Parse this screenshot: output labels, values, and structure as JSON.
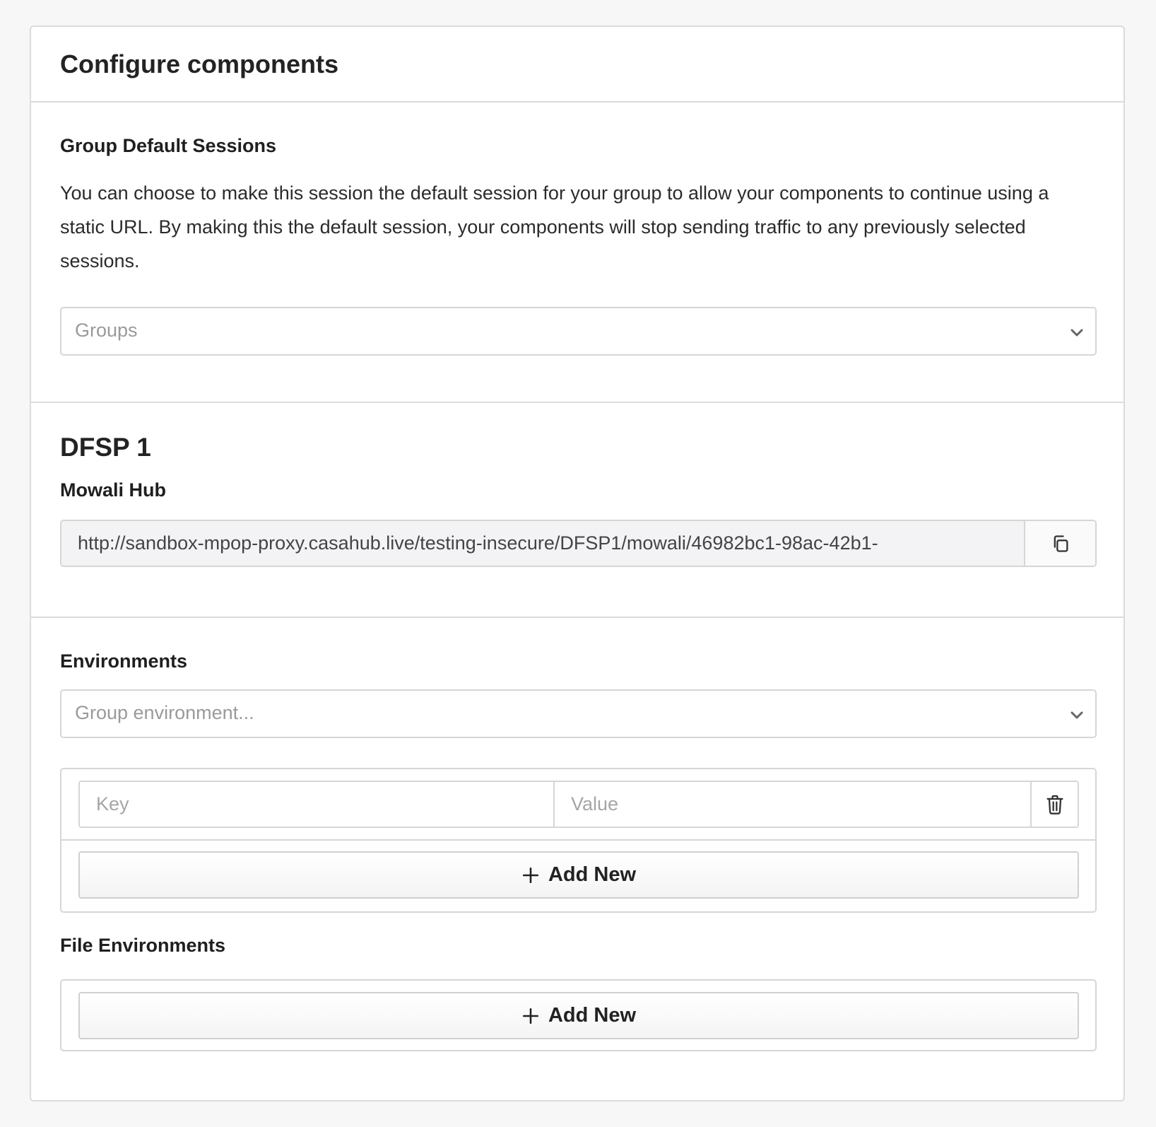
{
  "card": {
    "title": "Configure components"
  },
  "group_defaults": {
    "heading": "Group Default Sessions",
    "description": "You can choose to make this session the default session for your group to allow your components to continue using a static URL. By making this the default session, your components will stop sending traffic to any previously selected sessions.",
    "select_placeholder": "Groups",
    "select_icon": "chevron-down-icon"
  },
  "dfsp": {
    "title": "DFSP 1",
    "hub_label": "Mowali Hub",
    "url": "http://sandbox-mpop-proxy.casahub.live/testing-insecure/DFSP1/mowali/46982bc1-98ac-42b1-",
    "copy_icon": "copy-icon"
  },
  "environments": {
    "heading": "Environments",
    "select_placeholder": "Group environment...",
    "key_placeholder": "Key",
    "value_placeholder": "Value",
    "delete_icon": "trash-icon",
    "add_label": "Add New",
    "add_icon": "plus-icon"
  },
  "file_environments": {
    "heading": "File Environments",
    "add_label": "Add New",
    "add_icon": "plus-icon"
  }
}
